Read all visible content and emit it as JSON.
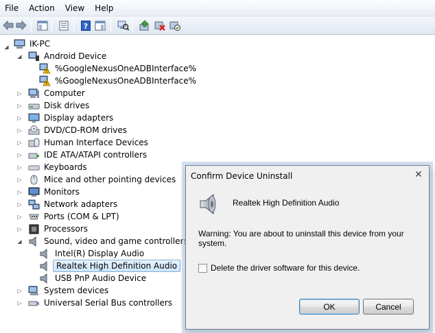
{
  "menu": [
    "File",
    "Action",
    "View",
    "Help"
  ],
  "toolbar": {
    "icons": [
      "back-arrow-icon",
      "forward-arrow-icon",
      "show-hide-console-tree-icon",
      "properties-icon",
      "help-icon",
      "show-action-pane-icon",
      "scan-hardware-icon",
      "update-driver-icon",
      "uninstall-icon",
      "enable-device-icon"
    ]
  },
  "tree": {
    "root": "IK-PC",
    "nodes": [
      {
        "label": "Android Device",
        "expanded": true,
        "icon": "android-device-icon"
      },
      {
        "label": "%GoogleNexusOneADBInterface%",
        "child": true,
        "icon": "warning-device-icon"
      },
      {
        "label": "%GoogleNexusOneADBInterface%",
        "child": true,
        "icon": "warning-device-icon"
      },
      {
        "label": "Computer",
        "icon": "computer-icon"
      },
      {
        "label": "Disk drives",
        "icon": "disk-drive-icon"
      },
      {
        "label": "Display adapters",
        "icon": "display-adapter-icon"
      },
      {
        "label": "DVD/CD-ROM drives",
        "icon": "dvd-drive-icon"
      },
      {
        "label": "Human Interface Devices",
        "icon": "hid-icon"
      },
      {
        "label": "IDE ATA/ATAPI controllers",
        "icon": "ide-controller-icon"
      },
      {
        "label": "Keyboards",
        "icon": "keyboard-icon"
      },
      {
        "label": "Mice and other pointing devices",
        "icon": "mouse-icon"
      },
      {
        "label": "Monitors",
        "icon": "monitor-icon"
      },
      {
        "label": "Network adapters",
        "icon": "network-adapter-icon"
      },
      {
        "label": "Ports (COM & LPT)",
        "icon": "port-icon"
      },
      {
        "label": "Processors",
        "icon": "processor-icon"
      },
      {
        "label": "Sound, video and game controllers",
        "expanded": true,
        "icon": "speaker-icon"
      },
      {
        "label": "Intel(R) Display Audio",
        "child": true,
        "icon": "speaker-icon"
      },
      {
        "label": "Realtek High Definition Audio",
        "child": true,
        "selected": true,
        "icon": "speaker-icon"
      },
      {
        "label": "USB PnP Audio Device",
        "child": true,
        "icon": "speaker-icon"
      },
      {
        "label": "System devices",
        "icon": "system-device-icon"
      },
      {
        "label": "Universal Serial Bus controllers",
        "icon": "usb-controller-icon"
      }
    ]
  },
  "dialog": {
    "title": "Confirm Device Uninstall",
    "device_name": "Realtek High Definition Audio",
    "warning": "Warning: You are about to uninstall this device from your system.",
    "checkbox_label": "Delete the driver software for this device.",
    "checkbox_checked": false,
    "ok_label": "OK",
    "cancel_label": "Cancel",
    "close_glyph": "✕"
  },
  "colors": {
    "accent": "#3c7fb1",
    "selection": "#cde6fb",
    "warning": "#f5c400"
  }
}
